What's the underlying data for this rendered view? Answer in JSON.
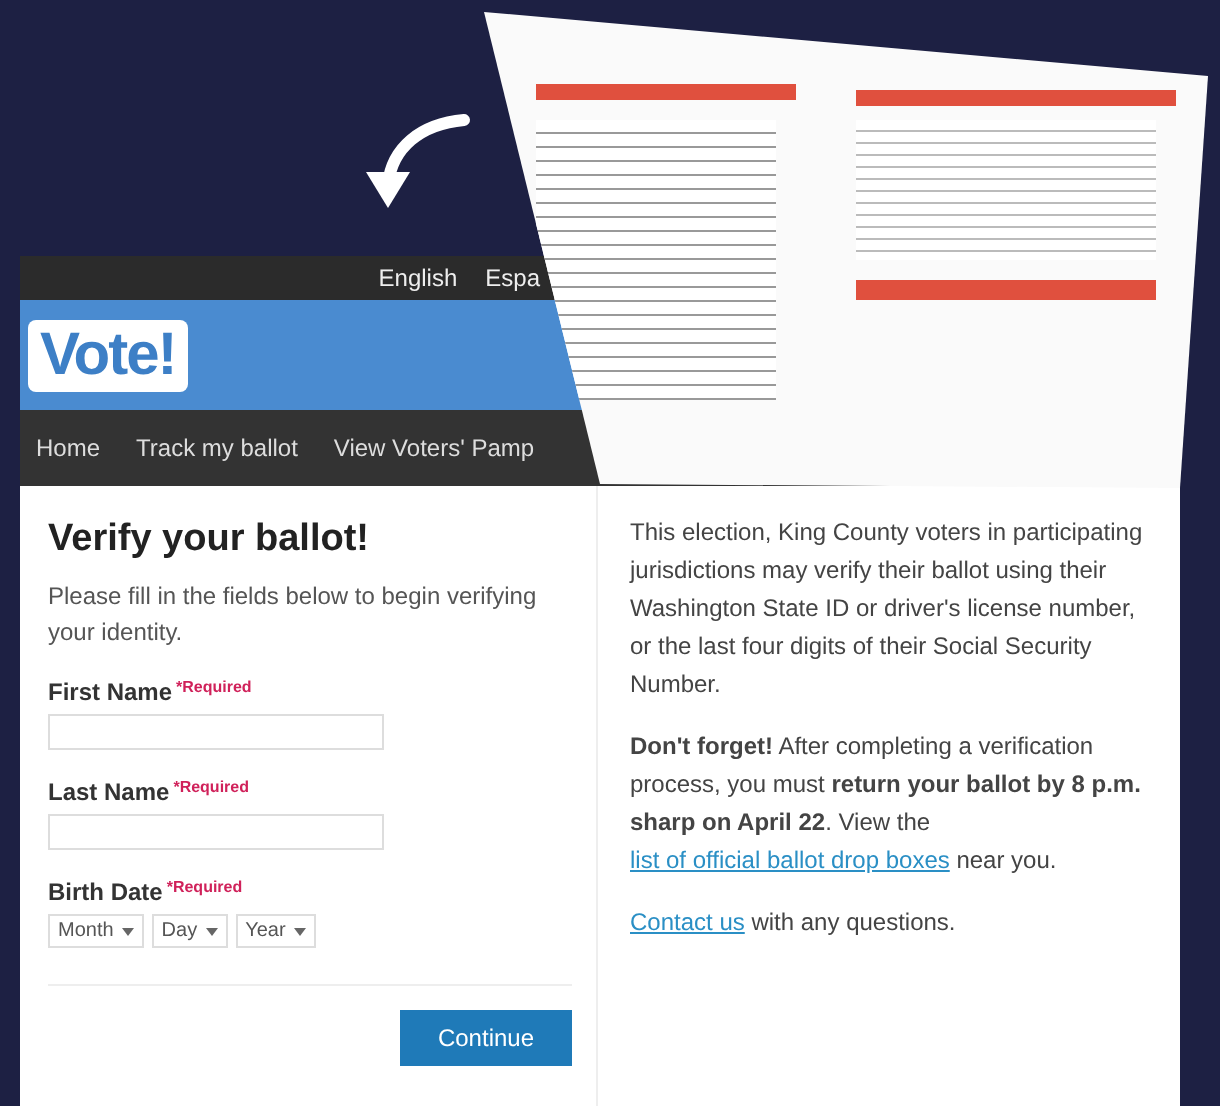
{
  "top_bar": {
    "languages": [
      "English",
      "Espa"
    ]
  },
  "header": {
    "logo_text": "Vote!"
  },
  "nav": {
    "items": [
      "Home",
      "Track my ballot",
      "View Voters' Pamp"
    ]
  },
  "form": {
    "title": "Verify your ballot!",
    "intro": "Please fill in the fields below to begin verifying your identity.",
    "fields": [
      {
        "label": "First Name",
        "required": "*Required",
        "kind": "text"
      },
      {
        "label": "Last Name",
        "required": "*Required",
        "kind": "text"
      },
      {
        "label": "Birth Date",
        "required": "*Required",
        "kind": "date",
        "selects": [
          "Month",
          "Day",
          "Year"
        ]
      }
    ],
    "button": "Continue"
  },
  "info": {
    "paragraphs": [
      [
        {
          "kind": "plain",
          "text": "This election, King County voters in participating jurisdictions may verify their ballot using their Washington State ID or driver's license number, or the last four digits of their Social Security Number."
        }
      ],
      [
        {
          "kind": "bold",
          "text": "Don't forget!"
        },
        {
          "kind": "plain",
          "text": " After completing a verification process, you must "
        },
        {
          "kind": "bold",
          "text": "return your ballot by 8 p.m. sharp on April 22"
        },
        {
          "kind": "plain",
          "text": ". View the "
        },
        {
          "kind": "link",
          "text": "list of official ballot drop boxes"
        },
        {
          "kind": "plain",
          "text": " near you."
        }
      ],
      [
        {
          "kind": "link",
          "text": "Contact us"
        },
        {
          "kind": "plain",
          "text": " with any questions."
        }
      ]
    ]
  }
}
